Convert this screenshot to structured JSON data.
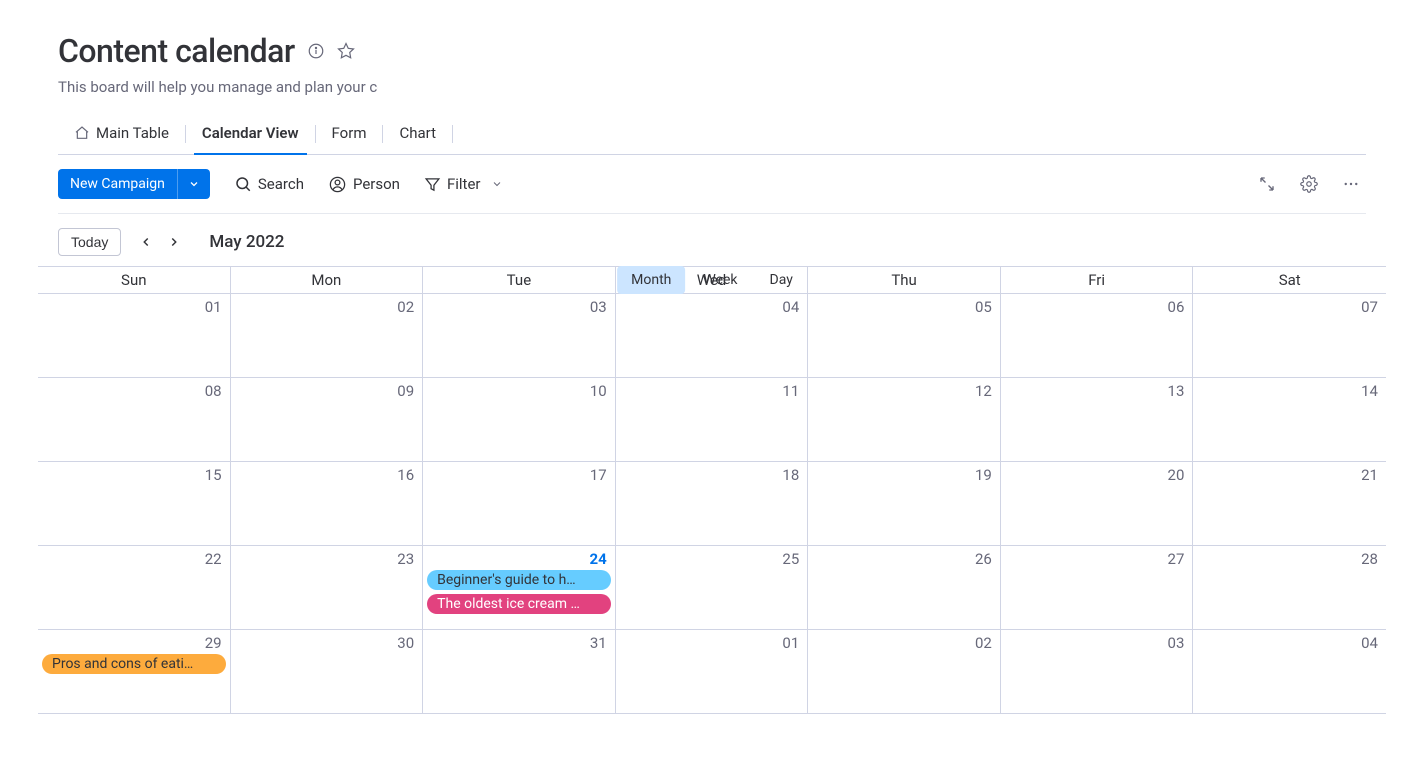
{
  "header": {
    "title": "Content calendar",
    "subtitle": "This board will help you manage and plan your conte"
  },
  "tabs": [
    {
      "label": "Main Table",
      "icon": "home",
      "active": false
    },
    {
      "label": "Calendar View",
      "icon": null,
      "active": true
    },
    {
      "label": "Form",
      "icon": null,
      "active": false
    },
    {
      "label": "Chart",
      "icon": null,
      "active": false
    }
  ],
  "toolbar": {
    "new_campaign": "New Campaign",
    "search": "Search",
    "person": "Person",
    "filter": "Filter"
  },
  "controls": {
    "today": "Today",
    "month_label": "May 2022",
    "views": [
      "Month",
      "Week",
      "Day"
    ],
    "active_view": "Month"
  },
  "calendar": {
    "day_names": [
      "Sun",
      "Mon",
      "Tue",
      "Wed",
      "Thu",
      "Fri",
      "Sat"
    ],
    "today": "24",
    "weeks": [
      [
        "01",
        "02",
        "03",
        "04",
        "05",
        "06",
        "07"
      ],
      [
        "08",
        "09",
        "10",
        "11",
        "12",
        "13",
        "14"
      ],
      [
        "15",
        "16",
        "17",
        "18",
        "19",
        "20",
        "21"
      ],
      [
        "22",
        "23",
        "24",
        "25",
        "26",
        "27",
        "28"
      ],
      [
        "29",
        "30",
        "31",
        "01",
        "02",
        "03",
        "04"
      ]
    ],
    "events": {
      "3-2": [
        {
          "title": "Beginner's guide to h…",
          "color": "#66ccff"
        },
        {
          "title": "The oldest ice cream …",
          "color": "#e2427f",
          "text": "#fff"
        }
      ],
      "4-0": [
        {
          "title": "Pros and cons of eati…",
          "color": "#fdab3d"
        }
      ]
    }
  }
}
